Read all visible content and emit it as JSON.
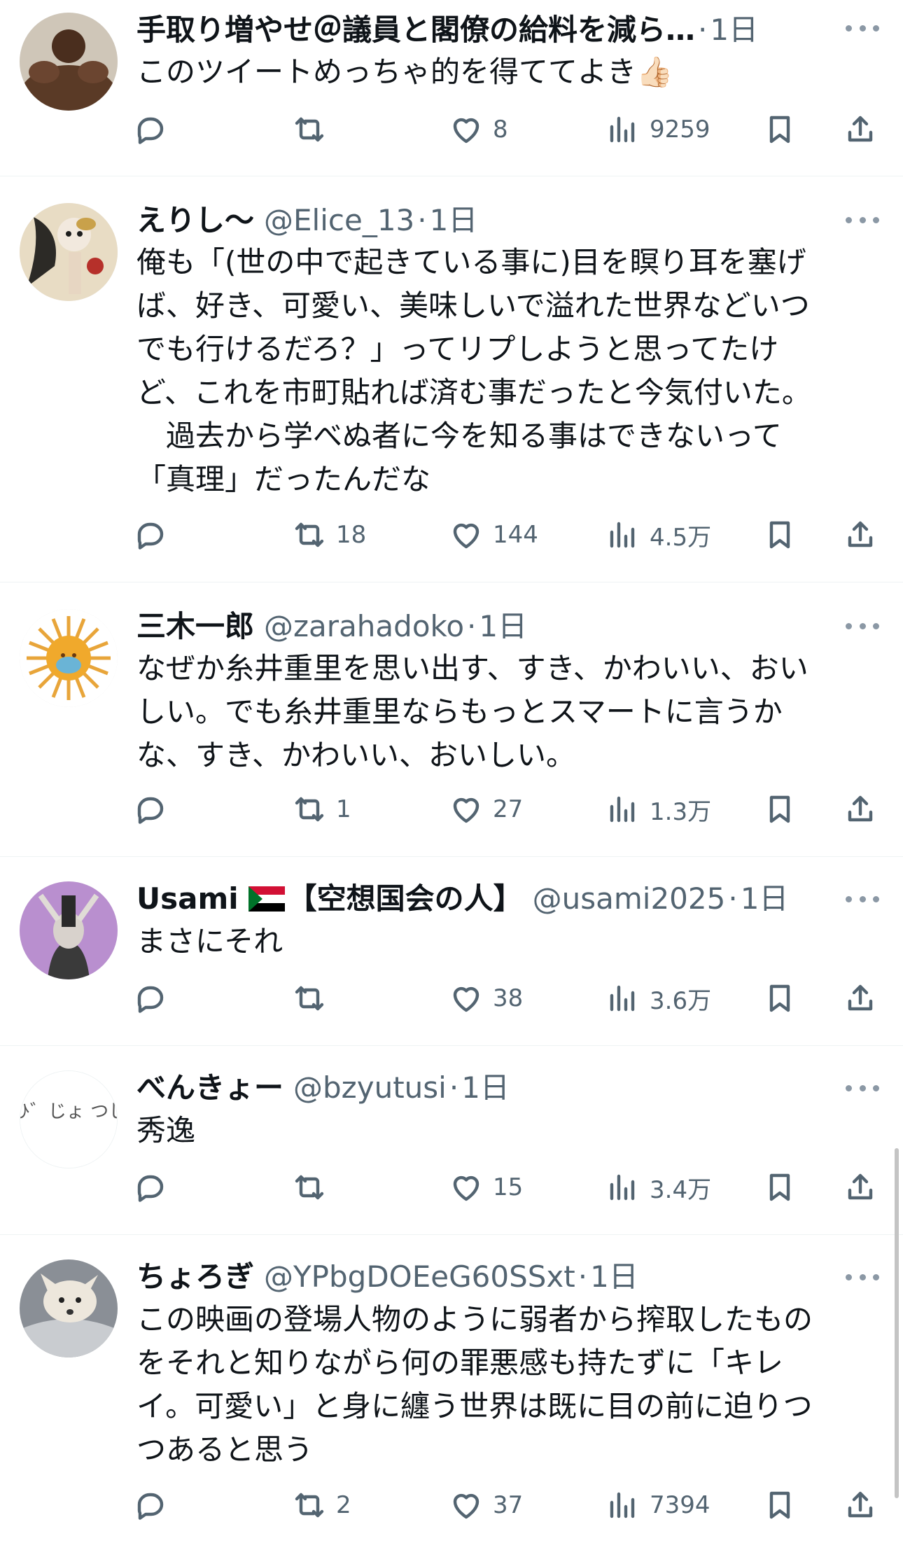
{
  "tweets": [
    {
      "name": "手取り増やせ＠議員と閣僚の給料を減ら…",
      "handle": "",
      "time": "1日",
      "text": "このツイートめっちゃ的を得ててよき👍🏻",
      "replies": "",
      "retweets": "",
      "likes": "8",
      "views": "9259"
    },
    {
      "name": "えりし〜",
      "handle": "@Elice_13",
      "time": "1日",
      "text": "俺も「(世の中で起きている事に)目を瞑り耳を塞げ\nば、好き、可愛い、美味しいで溢れた世界などいつ\nでも行けるだろ？」ってリプしようと思ってたけ\nど、これを市町貼れば済む事だったと今気付いた。\n　過去から学べぬ者に今を知る事はできないって\n「真理」だったんだな",
      "replies": "",
      "retweets": "18",
      "likes": "144",
      "views": "4.5万"
    },
    {
      "name": "三木一郎",
      "handle": "@zarahadoko",
      "time": "1日",
      "text": "なぜか糸井重里を思い出す、すき、かわいい、おい\nしい。でも糸井重里ならもっとスマートに言うか\nな、すき、かわいい、おいしい。",
      "replies": "",
      "retweets": "1",
      "likes": "27",
      "views": "1.3万"
    },
    {
      "name": "Usami",
      "name_suffix": "【空想国会の人】",
      "handle": "@usami2025",
      "time": "1日",
      "text": "まさにそれ",
      "replies": "",
      "retweets": "",
      "likes": "38",
      "views": "3.6万"
    },
    {
      "name": "べんきょー",
      "handle": "@bzyutusi",
      "time": "1日",
      "text": "秀逸",
      "replies": "",
      "retweets": "",
      "likes": "15",
      "views": "3.4万"
    },
    {
      "name": "ちょろぎ",
      "handle": "@YPbgDOEeG60SSxt",
      "time": "1日",
      "text": "この映画の登場人物のように弱者から搾取したもの\nをそれと知りながら何の罪悪感も持たずに「キレ\nイ。可愛い」と身に纏う世界は既に目の前に迫りつ\nつあると思う",
      "replies": "",
      "retweets": "2",
      "likes": "37",
      "views": "7394"
    }
  ],
  "avatar_texts": {
    "t5": "ひ゛じょ つし"
  },
  "icons": {
    "reply": "reply-icon",
    "retweet": "retweet-icon",
    "like": "heart-icon",
    "views": "views-icon",
    "bookmark": "bookmark-icon",
    "share": "share-icon",
    "more": "more-icon"
  },
  "colors": {
    "secondary_text": "#536471",
    "divider": "#eff3f4",
    "text": "#0f1419"
  }
}
